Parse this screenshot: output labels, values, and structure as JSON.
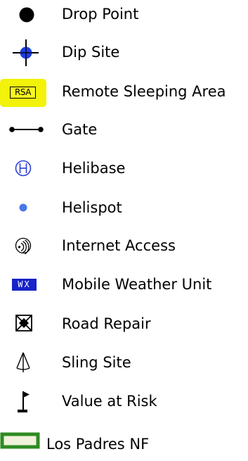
{
  "legend": {
    "items": [
      {
        "label": "Drop Point",
        "icon": "filled-circle-icon"
      },
      {
        "label": "Dip Site",
        "icon": "blue-crosshair-icon"
      },
      {
        "label": "Remote Sleeping Area",
        "icon": "rsa-tag-icon",
        "tag": "RSA"
      },
      {
        "label": "Gate",
        "icon": "gate-line-icon"
      },
      {
        "label": "Helibase",
        "icon": "helibase-circle-h-icon"
      },
      {
        "label": "Helispot",
        "icon": "helispot-dot-icon"
      },
      {
        "label": "Internet Access",
        "icon": "wifi-circle-icon"
      },
      {
        "label": "Mobile Weather Unit",
        "icon": "wx-tag-icon",
        "tag": "WX"
      },
      {
        "label": "Road Repair",
        "icon": "road-repair-box-icon"
      },
      {
        "label": "Sling Site",
        "icon": "sling-site-icon"
      },
      {
        "label": "Value at Risk",
        "icon": "flag-icon"
      },
      {
        "label": "Los Padres NF",
        "icon": "green-outline-rect-icon"
      }
    ]
  },
  "colors": {
    "dip_site_blue": "#1f3fe0",
    "rsa_highlight": "#f2f20a",
    "helibase_blue": "#2a3fd6",
    "helispot_blue": "#4a78e8",
    "wx_blue": "#1722c9",
    "forest_green": "#2e8b22",
    "forest_fill": "#f2f2dc"
  }
}
